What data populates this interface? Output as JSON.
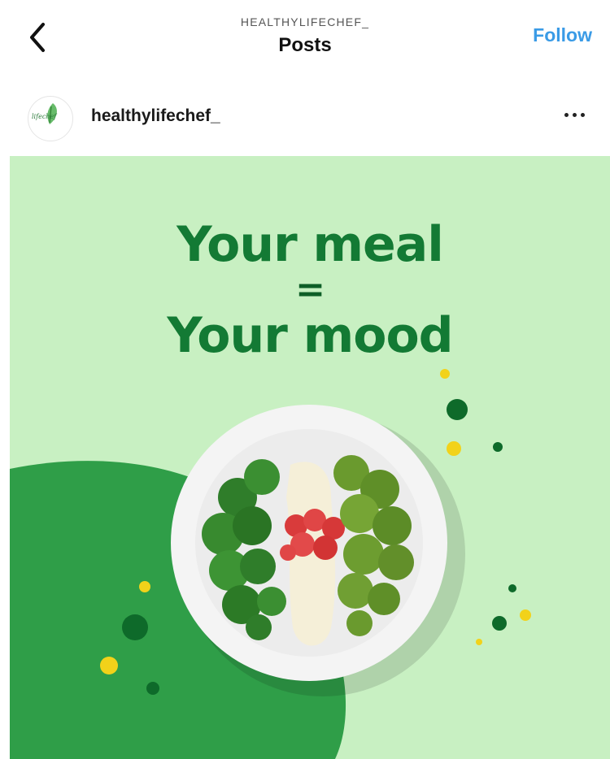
{
  "topbar": {
    "back_icon": "chevron-left-icon",
    "account_name": "HEALTHYLIFECHEF_",
    "title": "Posts",
    "follow_label": "Follow"
  },
  "post": {
    "username": "healthylifechef_",
    "avatar_text": "lifechef",
    "more_icon": "more-horizontal-icon",
    "image": {
      "headline_line1": "Your meal",
      "headline_equals": "=",
      "headline_line2": "Your mood"
    }
  },
  "colors": {
    "follow": "#3a9be6",
    "image_background": "#c8f0c2",
    "headline": "#137a34",
    "dark_green": "#2f9e48",
    "accent_yellow": "#f2d21a"
  }
}
